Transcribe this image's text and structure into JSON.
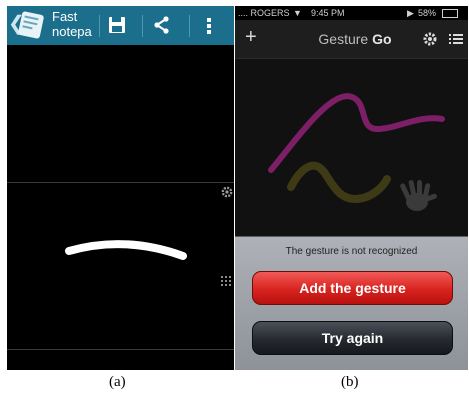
{
  "panel_a": {
    "app_title": "Fast\nnotepa",
    "icons": {
      "back": "chevron-left-icon",
      "app": "notepad-app-icon",
      "save": "floppy-disk-icon",
      "share": "share-icon",
      "menu": "overflow-menu-icon",
      "settings": "gear-icon",
      "grid": "keypad-grid-icon"
    }
  },
  "panel_b": {
    "status": {
      "carrier": ".... ROGERS",
      "time": "9:45 PM",
      "battery": "58%"
    },
    "nav": {
      "title_prefix": "Gesture ",
      "title_bold": "Go"
    },
    "sheet": {
      "message": "The gesture is not recognized",
      "add_button": "Add the gesture",
      "try_button": "Try again"
    },
    "colors": {
      "accent_red": "#d8231f",
      "stroke_magenta": "#7d1f66",
      "stroke_olive": "#3e3a16"
    }
  },
  "captions": {
    "a": "(a)",
    "b": "(b)"
  }
}
